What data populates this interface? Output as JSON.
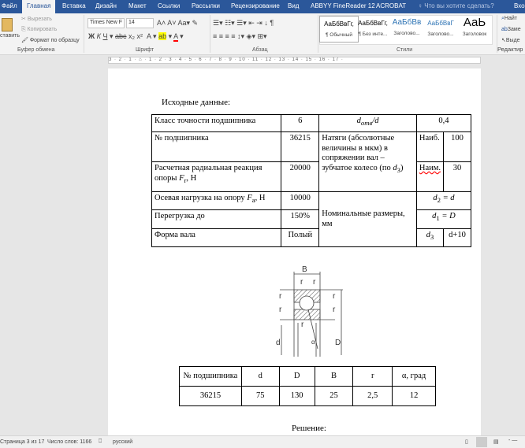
{
  "tabs": [
    "Файл",
    "Главная",
    "Вставка",
    "Дизайн",
    "Макет",
    "Ссылки",
    "Рассылки",
    "Рецензирование",
    "Вид",
    "ABBYY FineReader 12",
    "ACROBAT"
  ],
  "tell_me": "Что вы хотите сделать?",
  "user": "Вхо",
  "clipboard": {
    "paste": "ставить",
    "cut": "Вырезать",
    "copy": "Копировать",
    "format_painter": "Формат по образцу",
    "group": "Буфер обмена"
  },
  "font": {
    "name": "Times New F",
    "size": "14",
    "group": "Шрифт"
  },
  "paragraph": {
    "group": "Абзац"
  },
  "styles": {
    "group": "Стили",
    "items": [
      {
        "sample": "АаБбВвГг,",
        "name": "¶ Обычный"
      },
      {
        "sample": "АаБбВвГг,",
        "name": "¶ Без инте..."
      },
      {
        "sample": "АаБбВв",
        "name": "Заголово..."
      },
      {
        "sample": "АаБбВвГ",
        "name": "Заголово..."
      },
      {
        "sample": "АаЬ",
        "name": "Заголовок"
      }
    ]
  },
  "editing": {
    "find": "Найт",
    "replace": "Заме",
    "select": "Выде",
    "group": "Редактир"
  },
  "ruler": "3 · 2 · 1 · ⌂ · 1 · 2 · 3 · 4 · 5 · 6 · 7 · 8 · 9 · 10 · 11 · 12 · 13 · 14 · 15 · 16 · 17 ·",
  "doc": {
    "heading": "Исходные данные:",
    "t1": {
      "r1": [
        "Класс точности подшипника",
        "6",
        "d",
        "отв",
        "/d",
        "0,4"
      ],
      "r2": [
        "№ подшипника",
        "36215",
        "Натяги (абсолютные величины в мкм) в сопряжении вал – зубчатое колесо (по ",
        "d",
        "3",
        ")",
        "Наиб.",
        "100"
      ],
      "r3": [
        "Расчетная радиальная реакция опоры ",
        "F",
        "r",
        ", Н",
        "20000",
        "Наим.",
        "30"
      ],
      "r4": [
        "Осевая нагрузка на опору ",
        "F",
        "a",
        ", Н",
        "10000",
        "d",
        "2",
        " = d"
      ],
      "r5": [
        "Перегрузка до",
        "150%",
        "Номинальные размеры, мм",
        "d",
        "1",
        " = D"
      ],
      "r6": [
        "Форма вала",
        "Полый",
        "d",
        "3",
        "d+10"
      ]
    },
    "diagram_labels": [
      "B",
      "r",
      "r",
      "r",
      "r",
      "r",
      "r",
      "r",
      "d",
      "D",
      "α"
    ],
    "t2": {
      "headers": [
        "№ подшипника",
        "d",
        "D",
        "B",
        "r",
        "α, град"
      ],
      "values": [
        "36215",
        "75",
        "130",
        "25",
        "2,5",
        "12"
      ]
    },
    "solution": "Решение:"
  },
  "status": {
    "page": "Страница 3 из 17",
    "words": "Число слов: 1166",
    "lang": "русский"
  }
}
